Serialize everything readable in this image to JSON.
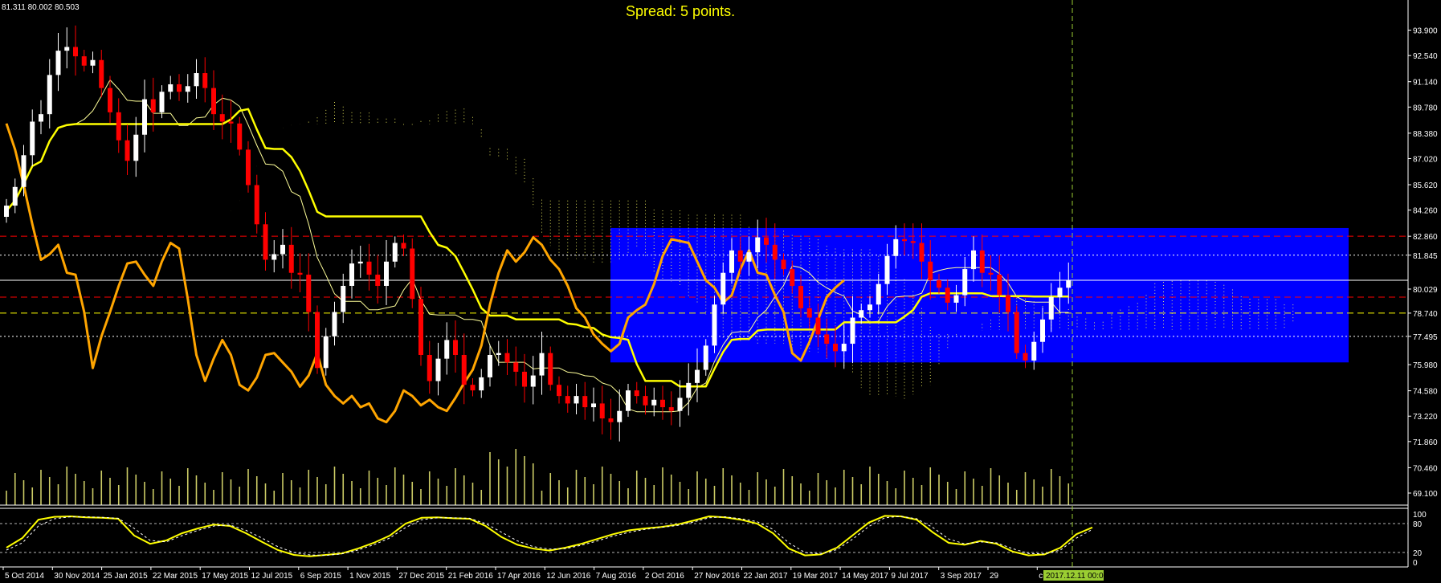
{
  "header": {
    "ohlc": "81.311 80.002 80.503",
    "spread": "Spread: 5 points."
  },
  "colors": {
    "background": "#000000",
    "bull_candle": "#ffffff",
    "bear_candle": "#ff0000",
    "highlight_box": "#0000ff",
    "kijun": "#ffff00",
    "chikou": "#ffa500",
    "tenkan": "#ffff99",
    "cloud": "#ffff66",
    "volume": "#cccc66",
    "stoch_main": "#ffff00",
    "stoch_signal": "#ffffff",
    "level_red": "#ff0000",
    "time_marker": "#9acd32"
  },
  "chart_data": [
    {
      "type": "candlestick",
      "indicators": [
        "Ichimoku Kinko Hyo",
        "Volume"
      ],
      "y_axis": {
        "ylim": [
          69.1,
          95.0
        ],
        "tick_labels": [
          "93.900",
          "92.540",
          "91.140",
          "89.780",
          "88.380",
          "87.020",
          "85.620",
          "84.260",
          "82.860",
          "81.845",
          "80.029",
          "78.740",
          "77.495",
          "75.980",
          "74.580",
          "73.220",
          "71.860",
          "70.460",
          "69.100"
        ],
        "tick_values": [
          93.9,
          92.54,
          91.14,
          89.78,
          88.38,
          87.02,
          85.62,
          84.26,
          82.86,
          81.845,
          80.029,
          78.74,
          77.495,
          75.98,
          74.58,
          73.22,
          71.86,
          70.46,
          69.1
        ]
      },
      "x_axis": {
        "tick_labels": [
          "5 Oct 2014",
          "30 Nov 2014",
          "25 Jan 2015",
          "22 Mar 2015",
          "17 May 2015",
          "12 Jul 2015",
          "6 Sep 2015",
          "1 Nov 2015",
          "27 Dec 2015",
          "21 Feb 2016",
          "17 Apr 2016",
          "12 Jun 2016",
          "7 Aug 2016",
          "2 Oct 2016",
          "27 Nov 2016",
          "22 Jan 2017",
          "19 Mar 2017",
          "14 May 2017",
          "9 Jul 2017",
          "3 Sep 2017",
          "29",
          "c 2017"
        ],
        "marker_label": "2017.12.11 00:00"
      },
      "highlight_box": {
        "y_range": [
          76.1,
          83.3
        ],
        "x_range": [
          "12 Jun 2016",
          "Dec 2017"
        ]
      },
      "horizontal_levels": [
        {
          "value": 82.86,
          "style": "dashed",
          "color": "red"
        },
        {
          "value": 81.845,
          "style": "dotted",
          "color": "white"
        },
        {
          "value": 80.5,
          "style": "solid",
          "color": "white"
        },
        {
          "value": 79.6,
          "style": "dashed",
          "color": "red"
        },
        {
          "value": 78.74,
          "style": "dashed",
          "color": "yellow"
        },
        {
          "value": 77.495,
          "style": "dotted",
          "color": "white"
        }
      ],
      "series": [
        {
          "name": "Close",
          "values": [
            84.5,
            85.5,
            87.2,
            89.0,
            89.4,
            91.5,
            92.8,
            93.0,
            92.5,
            92.0,
            92.3,
            90.8,
            89.5,
            88.0,
            86.9,
            88.3,
            90.2,
            89.5,
            90.6,
            91.0,
            90.6,
            90.9,
            91.6,
            90.8,
            89.4,
            89.0,
            88.9,
            87.5,
            85.6,
            83.5,
            81.6,
            81.9,
            82.4,
            80.9,
            80.8,
            78.8,
            75.8,
            77.5,
            78.8,
            80.2,
            81.4,
            81.5,
            80.8,
            80.2,
            81.5,
            82.5,
            82.2,
            79.5,
            76.5,
            75.1,
            76.3,
            77.3,
            76.5,
            74.9,
            74.6,
            75.3,
            76.5,
            76.6,
            76.1,
            75.6,
            74.8,
            75.4,
            76.6,
            74.9,
            74.3,
            73.9,
            74.3,
            73.7,
            73.9,
            73.1,
            72.9,
            73.5,
            74.6,
            74.3,
            73.8,
            74.1,
            73.7,
            73.5,
            74.2,
            75.0,
            75.7,
            77.0,
            79.2,
            80.9,
            82.1,
            81.5,
            82.0,
            82.8,
            82.4,
            81.6,
            81.1,
            80.2,
            79.0,
            78.5,
            77.6,
            77.1,
            76.7,
            77.1,
            78.5,
            78.9,
            79.2,
            80.3,
            81.8,
            82.7,
            82.6,
            82.5,
            81.5,
            80.5,
            80.1,
            79.3,
            79.7,
            81.1,
            82.1,
            80.9,
            80.8,
            79.7,
            78.8,
            76.6,
            76.2,
            77.2,
            78.4,
            79.6,
            80.1,
            80.5
          ],
          "note": "approximate weekly closes, candles read off the price axis"
        },
        {
          "name": "Tenkan-sen",
          "role": "thin yellow line"
        },
        {
          "name": "Kijun-sen",
          "role": "thick yellow line"
        },
        {
          "name": "Chikou Span",
          "role": "thick orange line"
        },
        {
          "name": "Senkou Span A / B",
          "role": "dotted cloud"
        }
      ]
    },
    {
      "type": "line",
      "indicator": "Stochastic Oscillator",
      "ylim": [
        0,
        100
      ],
      "tick_labels": [
        "100",
        "80",
        "20",
        "0"
      ],
      "tick_values": [
        100,
        80,
        20,
        0
      ],
      "series": [
        {
          "name": "%K",
          "values": [
            30,
            50,
            88,
            94,
            95,
            93,
            92,
            90,
            55,
            38,
            45,
            60,
            70,
            78,
            75,
            60,
            42,
            25,
            15,
            12,
            15,
            18,
            28,
            40,
            55,
            80,
            92,
            93,
            91,
            90,
            75,
            52,
            36,
            28,
            24,
            30,
            38,
            48,
            58,
            66,
            70,
            73,
            78,
            86,
            95,
            93,
            88,
            80,
            60,
            28,
            14,
            16,
            30,
            56,
            82,
            96,
            95,
            88,
            62,
            40,
            36,
            44,
            38,
            22,
            14,
            16,
            30,
            58,
            72
          ]
        },
        {
          "name": "%D",
          "values": [
            25,
            40,
            75,
            90,
            94,
            94,
            93,
            91,
            70,
            45,
            42,
            55,
            66,
            75,
            77,
            66,
            50,
            32,
            20,
            15,
            14,
            17,
            25,
            36,
            50,
            72,
            88,
            92,
            92,
            91,
            80,
            62,
            44,
            32,
            27,
            28,
            35,
            44,
            54,
            62,
            68,
            72,
            76,
            83,
            92,
            94,
            90,
            84,
            68,
            40,
            20,
            17,
            26,
            48,
            74,
            92,
            95,
            90,
            72,
            48,
            38,
            42,
            40,
            28,
            18,
            17,
            25,
            50,
            68
          ]
        }
      ]
    }
  ]
}
